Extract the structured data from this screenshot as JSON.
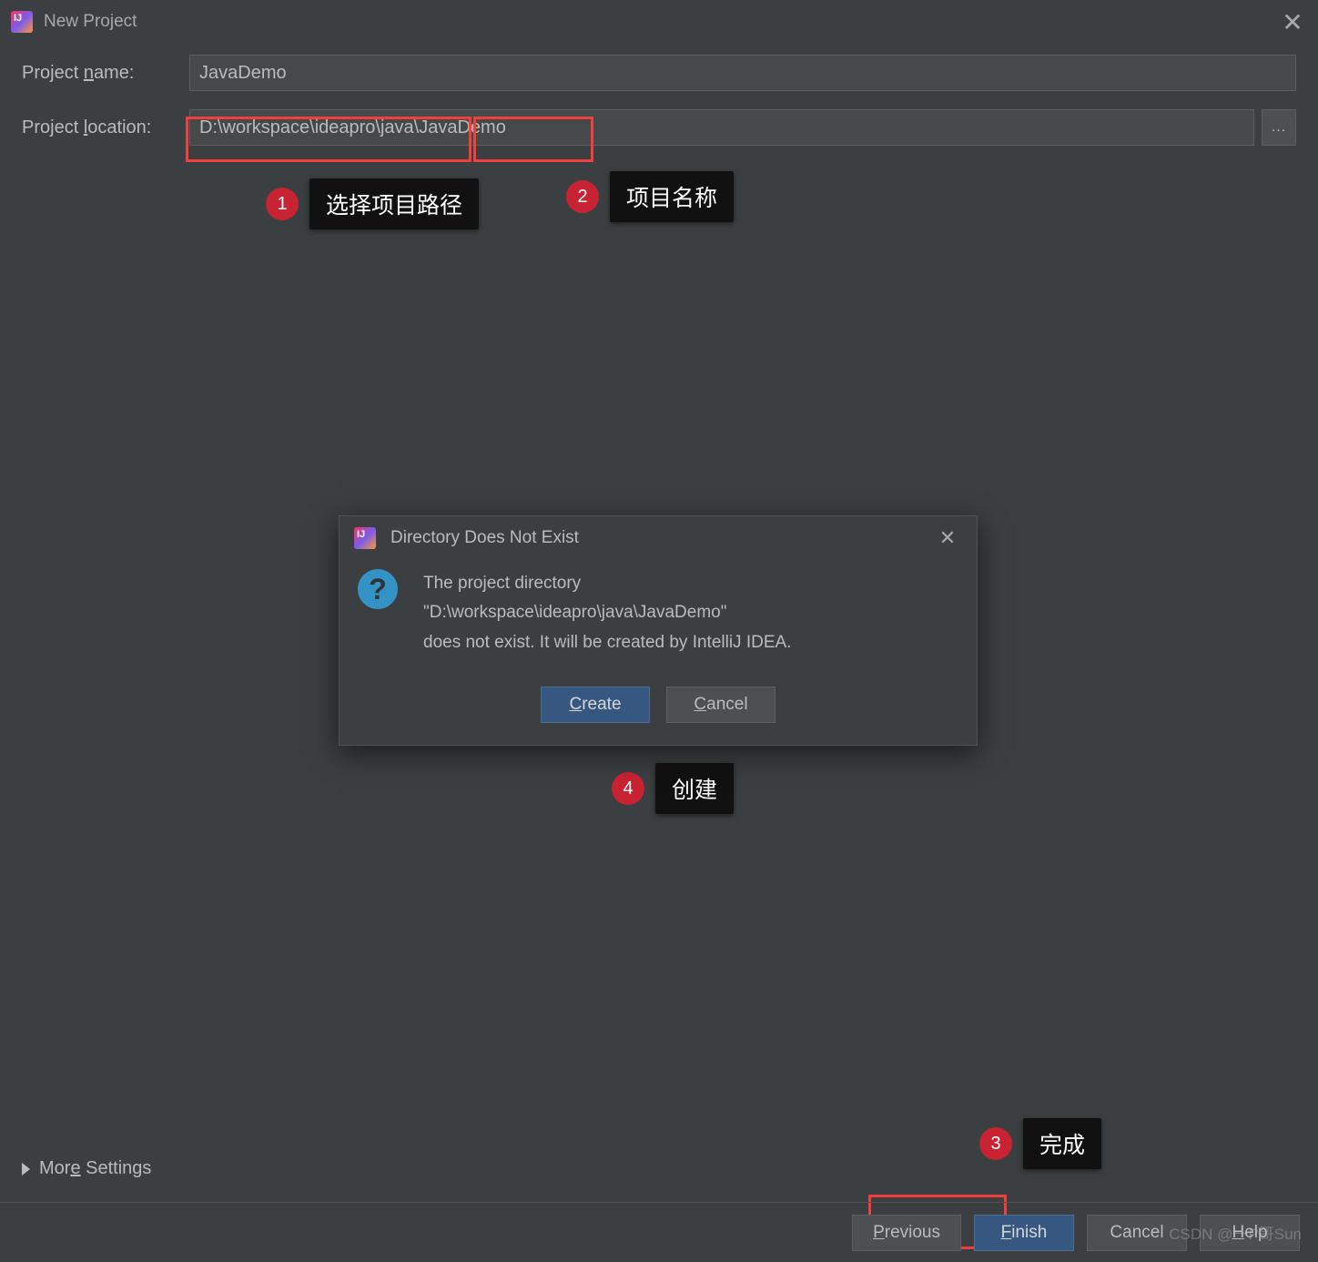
{
  "window": {
    "title": "New Project",
    "close": "✕"
  },
  "form": {
    "name_label_prefix": "Project ",
    "name_label_underline": "n",
    "name_label_suffix": "ame:",
    "name_value": "JavaDemo",
    "location_label_prefix": "Project ",
    "location_label_underline": "l",
    "location_label_suffix": "ocation:",
    "location_value": "D:\\workspace\\ideapro\\java\\JavaDemo",
    "browse": "..."
  },
  "callouts": {
    "c1_num": "1",
    "c1_text": "选择项目路径",
    "c2_num": "2",
    "c2_text": "项目名称",
    "c3_num": "3",
    "c3_text": "完成",
    "c4_num": "4",
    "c4_text": "创建"
  },
  "more_settings": {
    "label_prefix": "Mor",
    "label_underline": "e",
    "label_suffix": " Settings"
  },
  "footer": {
    "previous_u": "P",
    "previous_rest": "revious",
    "finish_u": "F",
    "finish_rest": "inish",
    "cancel": "Cancel",
    "help_u": "H",
    "help_rest": "elp"
  },
  "modal": {
    "title": "Directory Does Not Exist",
    "close": "✕",
    "line1": "The project directory",
    "line2": "\"D:\\workspace\\ideapro\\java\\JavaDemo\"",
    "line3": "does not exist. It will be created by IntelliJ IDEA.",
    "create_u": "C",
    "create_rest": "reate",
    "cancel_u": "C",
    "cancel_rest": "ancel"
  },
  "watermark": "CSDN @一P哥Sun"
}
